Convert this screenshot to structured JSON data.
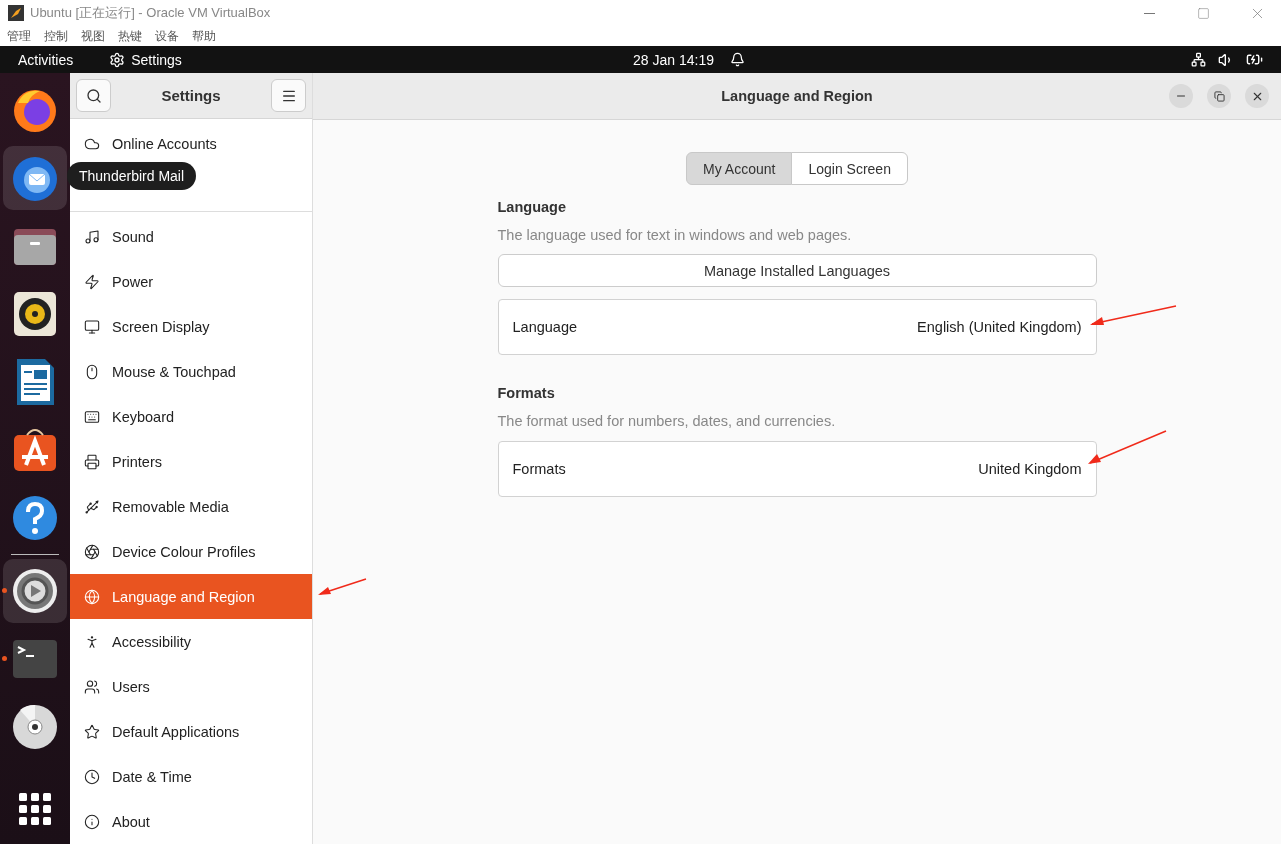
{
  "host_window": {
    "title": "Ubuntu [正在运行] - Oracle VM VirtualBox",
    "menu": [
      "管理",
      "控制",
      "视图",
      "热键",
      "设备",
      "帮助"
    ]
  },
  "top_bar": {
    "activities": "Activities",
    "app": "Settings",
    "clock": "28 Jan  14:19"
  },
  "dock": {
    "favorites": [
      {
        "kind": "browser",
        "highlighted": false,
        "running": false
      },
      {
        "kind": "mail",
        "highlighted": true,
        "running": false,
        "tooltip": "Thunderbird Mail"
      },
      {
        "kind": "files",
        "highlighted": false,
        "running": false
      },
      {
        "kind": "music",
        "highlighted": false,
        "running": false
      },
      {
        "kind": "writer",
        "highlighted": false,
        "running": false
      },
      {
        "kind": "store",
        "highlighted": false,
        "running": false
      },
      {
        "kind": "help",
        "highlighted": false,
        "running": false
      }
    ],
    "others": [
      {
        "kind": "settings",
        "highlighted": true,
        "running": true
      },
      {
        "kind": "terminal",
        "highlighted": false,
        "running": true
      },
      {
        "kind": "disc",
        "highlighted": false,
        "running": false
      }
    ]
  },
  "sidebar": {
    "title": "Settings",
    "groups": [
      [
        {
          "label": "Online Accounts",
          "selected": false
        },
        {
          "selected": false
        }
      ],
      [
        {
          "label": "Sound",
          "selected": false
        },
        {
          "label": "Power",
          "selected": false
        },
        {
          "label": "Screen Display",
          "selected": false
        },
        {
          "label": "Mouse & Touchpad",
          "selected": false
        },
        {
          "label": "Keyboard",
          "selected": false
        },
        {
          "label": "Printers",
          "selected": false
        },
        {
          "label": "Removable Media",
          "selected": false
        },
        {
          "label": "Device Colour Profiles",
          "selected": false
        },
        {
          "label": "Language and Region",
          "selected": true
        },
        {
          "label": "Accessibility",
          "selected": false
        },
        {
          "label": "Users",
          "selected": false
        },
        {
          "label": "Default Applications",
          "selected": false
        },
        {
          "label": "Date & Time",
          "selected": false
        },
        {
          "label": "About",
          "selected": false
        }
      ]
    ]
  },
  "page": {
    "title": "Language and Region",
    "tabs": [
      {
        "label": "My Account",
        "selected": true
      },
      {
        "label": "Login Screen",
        "selected": false
      }
    ],
    "sections": [
      {
        "heading": "Language",
        "description": "The language used for text in windows and web pages.",
        "button": "Manage Installed Languages",
        "row": {
          "label": "Language",
          "value": "English (United Kingdom)"
        }
      },
      {
        "heading": "Formats",
        "description": "The format used for numbers, dates, and currencies.",
        "row": {
          "label": "Formats",
          "value": "United Kingdom"
        }
      }
    ]
  }
}
